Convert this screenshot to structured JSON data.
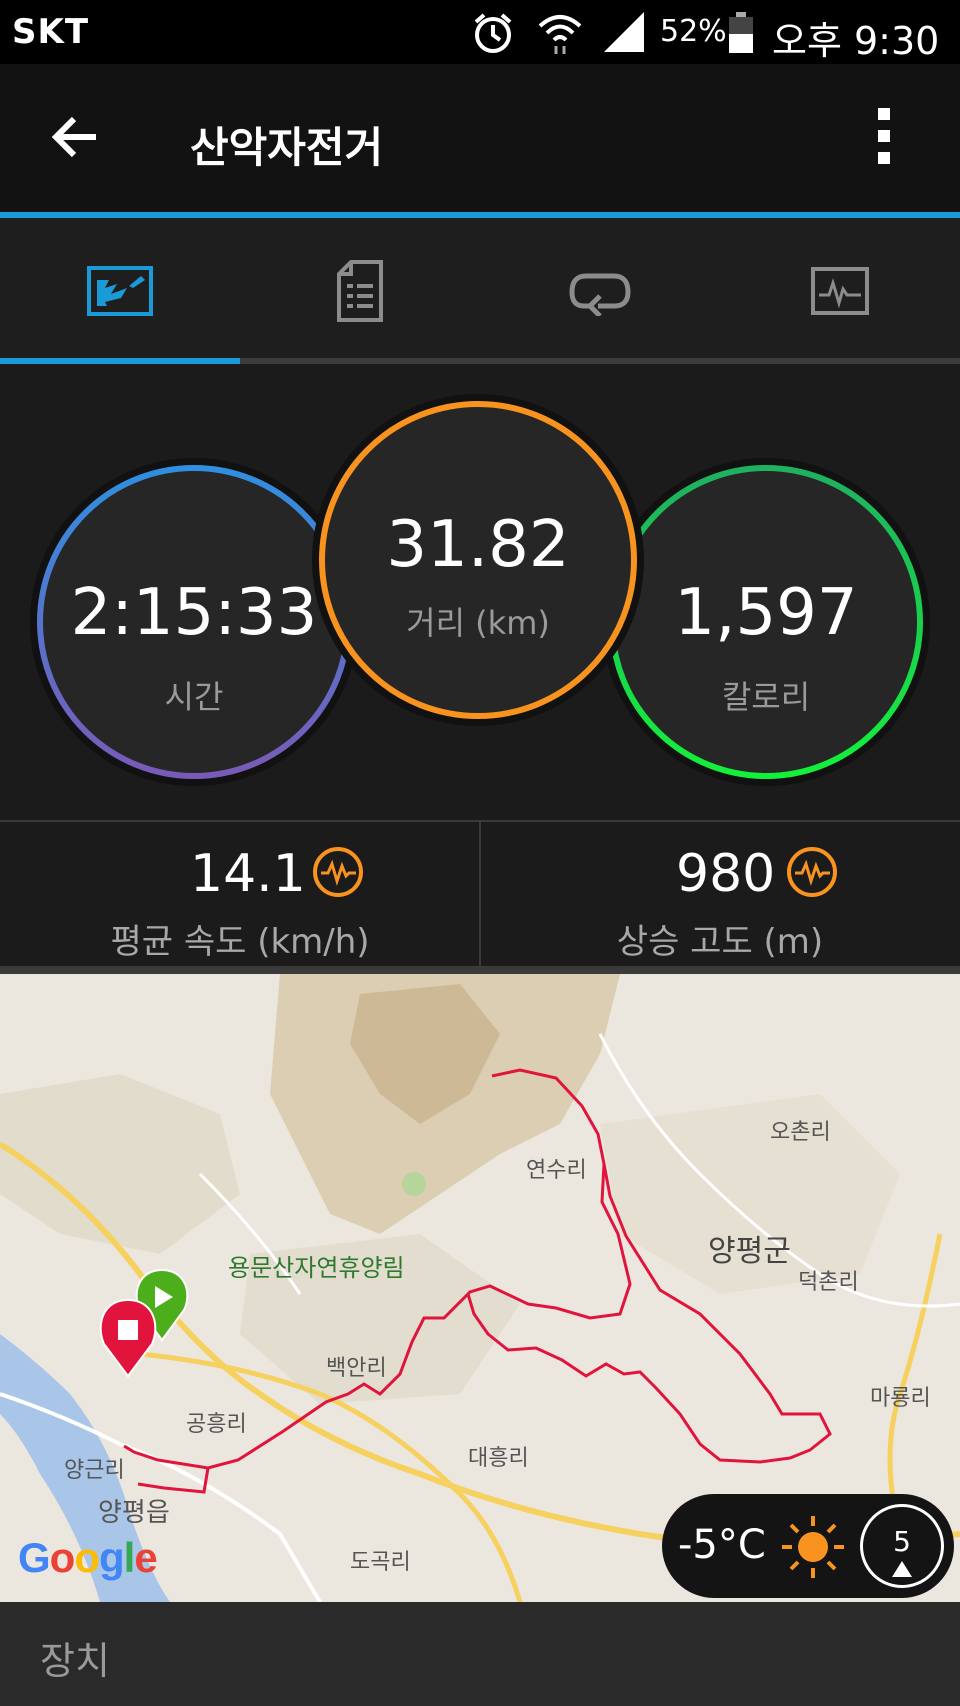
{
  "status_bar": {
    "carrier": "SKT",
    "battery_percent": "52%",
    "time": "오후 9:30"
  },
  "app_bar": {
    "title": "산악자전거",
    "back_icon": "arrow-left-icon",
    "menu_icon": "more-vertical-icon"
  },
  "tabs": [
    {
      "name": "map-overview",
      "icon": "map-chart-icon",
      "active": true
    },
    {
      "name": "details",
      "icon": "document-icon",
      "active": false
    },
    {
      "name": "laps",
      "icon": "loop-icon",
      "active": false
    },
    {
      "name": "charts",
      "icon": "pulse-chart-icon",
      "active": false
    }
  ],
  "stats": {
    "time": {
      "value": "2:15:33",
      "label": "시간"
    },
    "distance": {
      "value": "31.82",
      "label": "거리 (km)"
    },
    "calories": {
      "value": "1,597",
      "label": "칼로리"
    }
  },
  "metrics": {
    "avg_speed": {
      "value": "14.1",
      "label": "평균 속도 (km/h)"
    },
    "elevation_gain": {
      "value": "980",
      "label": "상승 고도 (m)"
    }
  },
  "map": {
    "labels": [
      "오촌리",
      "연수리",
      "양평군",
      "덕촌리",
      "용문산자연휴양림",
      "백안리",
      "마룡리",
      "공흥리",
      "양근리",
      "대흥리",
      "양평읍",
      "도곡리"
    ],
    "provider": "Google"
  },
  "weather": {
    "temperature": "-5°C",
    "wind": "5",
    "icon": "sun-icon"
  },
  "footer": {
    "label": "장치"
  },
  "colors": {
    "accent": "#1a9ad6",
    "time_ring": "#3f8fd8",
    "distance_ring": "#f7931e",
    "calories_ring": "#19d44a",
    "route": "#e0143c",
    "metric_icon": "#f7931e"
  }
}
